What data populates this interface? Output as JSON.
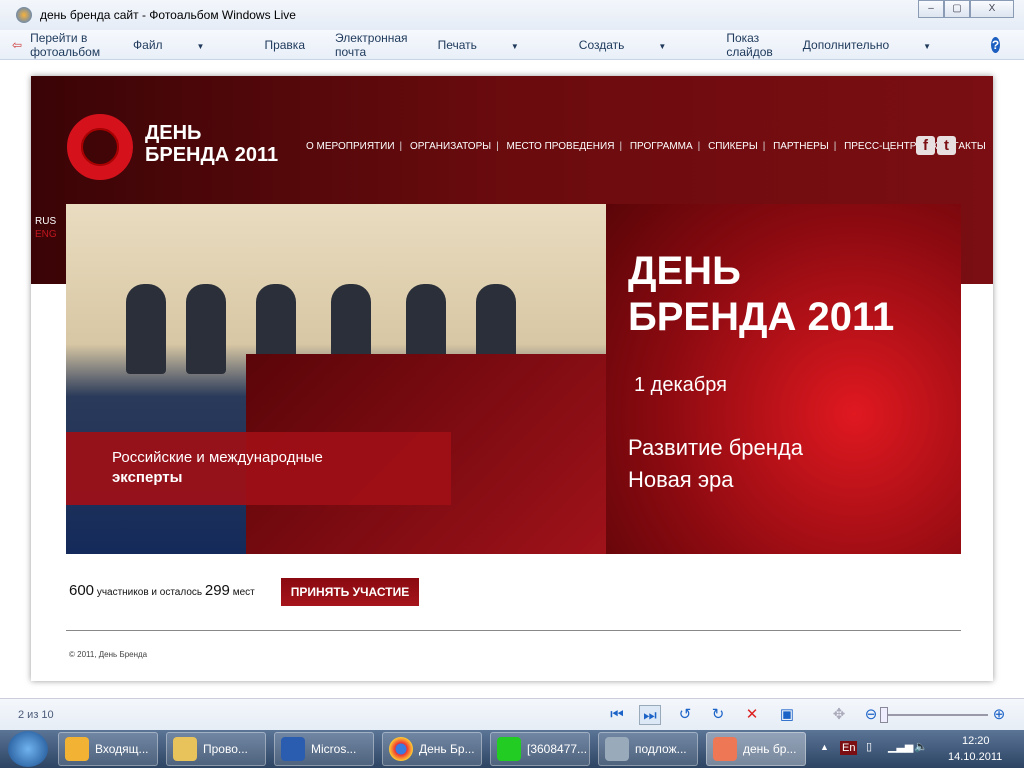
{
  "window": {
    "title": "день бренда сайт - Фотоальбом Windows Live",
    "minimize": "–",
    "maximize": "▢",
    "close": "X"
  },
  "menu": {
    "goto_album": "Перейти в фотоальбом",
    "file": "Файл",
    "edit": "Правка",
    "email": "Электронная почта",
    "print": "Печать",
    "create": "Создать",
    "slideshow": "Показ слайдов",
    "more": "Дополнительно",
    "help": "?"
  },
  "site": {
    "logo": {
      "line1": "ДЕНЬ",
      "line2": "БРЕНДА 2011"
    },
    "nav": [
      "О МЕРОПРИЯТИИ",
      "ОРГАНИЗАТОРЫ",
      "МЕСТО ПРОВЕДЕНИЯ",
      "ПРОГРАММА",
      "СПИКЕРЫ",
      "ПАРТНЕРЫ",
      "ПРЕСС-ЦЕНТР",
      "КОНТАКТЫ"
    ],
    "social": {
      "facebook": "f",
      "twitter": "t"
    },
    "lang": {
      "rus": "RUS",
      "eng": "ENG"
    },
    "caption": {
      "line1": "Российские и международные",
      "line2": "эксперты"
    },
    "promo": {
      "title1": "ДЕНЬ",
      "title2": "БРЕНДА 2011",
      "date": "1 декабря",
      "sub1": "Развитие бренда",
      "sub2": "Новая эра"
    },
    "stats": {
      "participants": "600",
      "text1": "участников и осталось",
      "remaining": "299",
      "text2": "мест"
    },
    "cta": "ПРИНЯТЬ УЧАСТИЕ",
    "copyright": "© 2011, День Бренда",
    "colors": {
      "brand": "#7a0e12",
      "accent": "#d5121c"
    }
  },
  "status": {
    "counter": "2 из 10"
  },
  "taskbar": {
    "items": [
      "Входящ...",
      "Прово...",
      "Micros...",
      "День Бр...",
      "[3608477...",
      "подлож...",
      "день бр..."
    ],
    "lang": "En",
    "time": "12:20",
    "date": "14.10.2011"
  }
}
